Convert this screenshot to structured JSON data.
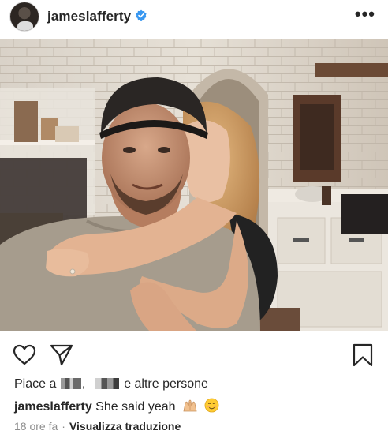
{
  "post": {
    "username": "jameslafferty",
    "verified": true,
    "more_icon": "more-horizontal-icon",
    "more_glyph": "•••"
  },
  "photo": {
    "icon": "post-photo"
  },
  "actions": {
    "like_icon": "heart-icon",
    "share_icon": "paper-plane-icon",
    "save_icon": "bookmark-icon"
  },
  "likes": {
    "prefix": "Piace a",
    "separator": ",",
    "suffix": "e altre persone"
  },
  "caption": {
    "username": "jameslafferty",
    "text": "She said yeah"
  },
  "meta": {
    "time": "18 ore fa",
    "separator": "·",
    "translate": "Visualizza traduzione"
  },
  "colors": {
    "text": "#262626",
    "muted": "#8e8e8e",
    "verified": "#3897f0"
  }
}
